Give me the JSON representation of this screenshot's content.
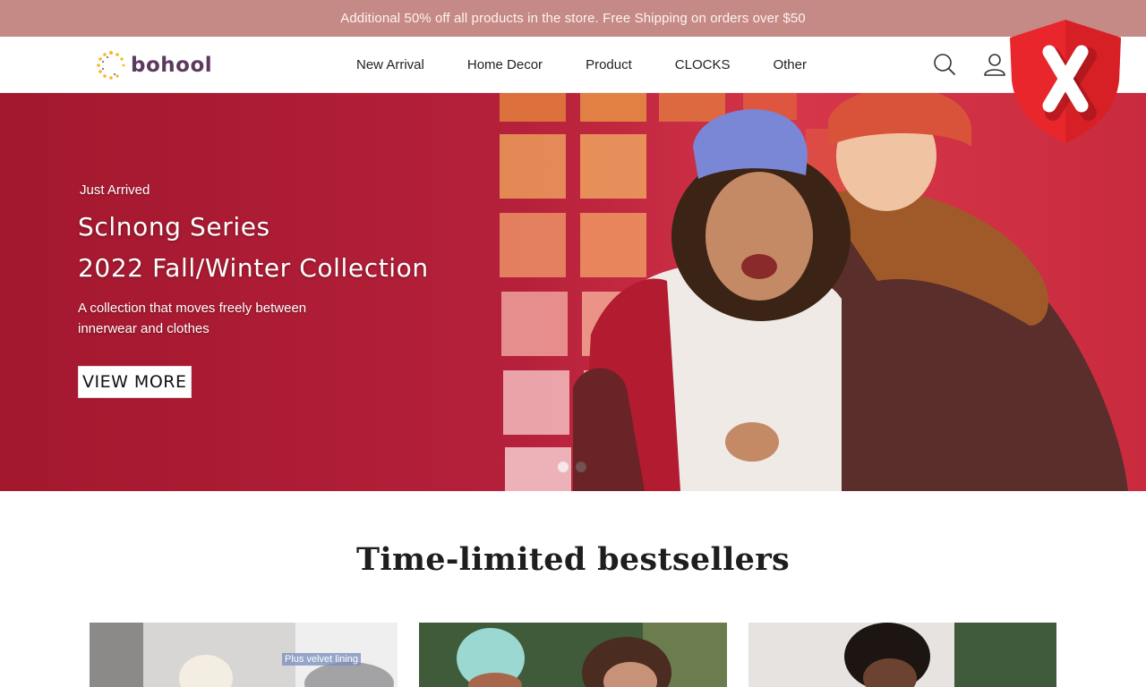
{
  "announcement": {
    "text": "Additional 50% off all products in the store. Free Shipping on orders over $50"
  },
  "header": {
    "logo_text": "bohool",
    "nav": [
      {
        "label": "New Arrival"
      },
      {
        "label": "Home Decor"
      },
      {
        "label": "Product"
      },
      {
        "label": "CLOCKS"
      },
      {
        "label": "Other"
      }
    ],
    "icons": [
      "search-icon",
      "account-icon"
    ]
  },
  "overlay": {
    "icon": "shield-x-icon",
    "color": "#e8262c"
  },
  "hero": {
    "kicker": "Just Arrived",
    "title_line1": "Sclnong Series",
    "title_line2": "2022 Fall/Winter Collection",
    "description": "A collection that moves freely between innerwear and clothes",
    "button_label": "VIEW MORE",
    "slides": [
      {
        "active": true
      },
      {
        "active": false
      }
    ],
    "colors": {
      "background": "#b01e35",
      "button_bg": "#ffffff"
    }
  },
  "bestsellers": {
    "title": "Time-limited bestsellers",
    "cards": [
      {
        "tag": "Plus velvet lining"
      },
      {
        "tag": ""
      },
      {
        "tag": ""
      }
    ]
  },
  "colors": {
    "announcement_bg": "#c68a86",
    "logo_text": "#5b3a5e"
  }
}
